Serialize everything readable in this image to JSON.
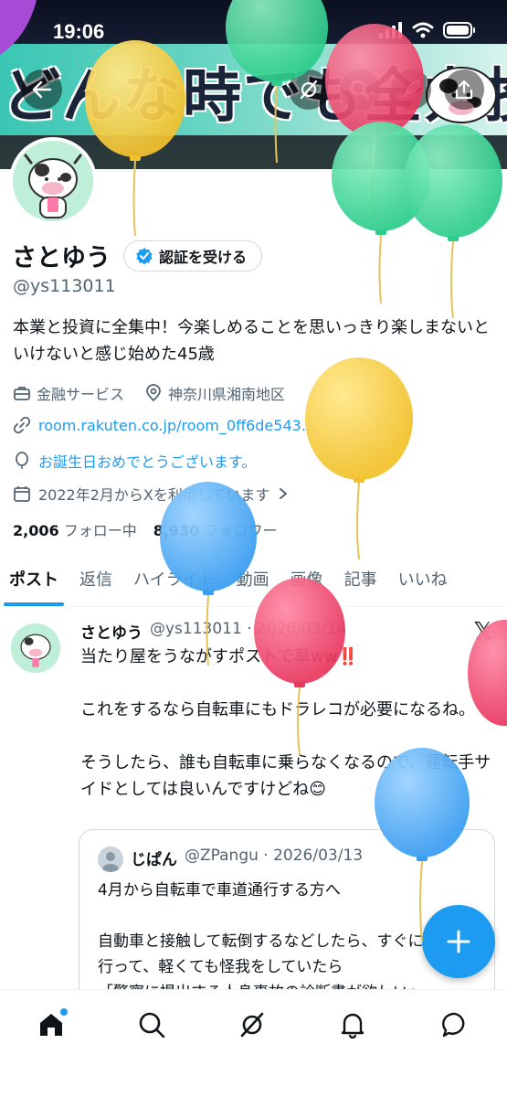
{
  "status_bar": {
    "time": "19:06"
  },
  "banner": {
    "text": "どんな時でも全力投資"
  },
  "profile": {
    "display_name": "さとゆう",
    "verify_label": "認証を受ける",
    "handle": "@ys113011",
    "bio": "本業と投資に全集中！今楽しめることを思いっきり楽しまないといけないと感じ始めた45歳",
    "category": "金融サービス",
    "location": "神奈川県湘南地区",
    "link": "room.rakuten.co.jp/room_0ff6de543...",
    "birthday": "お誕生日おめでとうございます。",
    "joined": "2022年2月からXを利用しています",
    "following_count": "2,006",
    "following_label": "フォロー中",
    "followers_count": "8,930",
    "followers_label": "フォロワー"
  },
  "tabs": [
    {
      "label": "ポスト"
    },
    {
      "label": "返信"
    },
    {
      "label": "ハイライト"
    },
    {
      "label": "動画"
    },
    {
      "label": "画像"
    },
    {
      "label": "記事"
    },
    {
      "label": "いいね"
    }
  ],
  "post": {
    "name": "さとゆう",
    "handle_date": "@ys113011 · 2026/03/14",
    "lines": [
      "当たり屋をうながすポストで草ww‼️",
      "これをするなら自転車にもドラレコが必要になるね。",
      "そうしたら、誰も自転車に乗らなくなるので、運転手サイドとしては良いんですけどね😊"
    ],
    "quote": {
      "name": "じぱん",
      "handle_date": "@ZPangu · 2026/03/13",
      "lines": [
        "4月から自転車で車道通行する方へ",
        "自動車と接触して転倒するなどしたら、すぐに病院へ行って、軽くても怪我をしていたら",
        "「警察に提出する人身事故の診断書が欲しい」"
      ]
    }
  },
  "colors": {
    "accent": "#1d9bf0",
    "text": "#0f1419",
    "muted": "#536471"
  }
}
